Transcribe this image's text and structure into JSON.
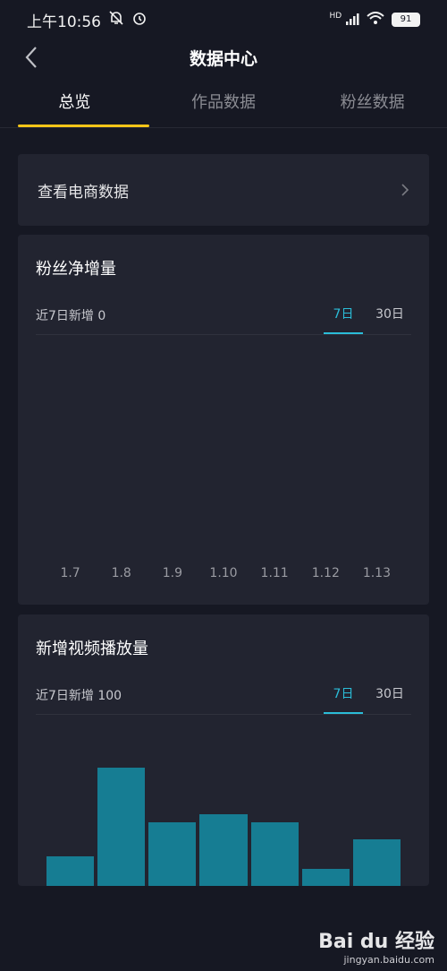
{
  "status_bar": {
    "time": "上午10:56",
    "network": "HD",
    "battery": "91"
  },
  "nav": {
    "title": "数据中心"
  },
  "tabs": [
    {
      "label": "总览",
      "active": true
    },
    {
      "label": "作品数据",
      "active": false
    },
    {
      "label": "粉丝数据",
      "active": false
    }
  ],
  "ecommerce": {
    "label": "查看电商数据"
  },
  "fans_card": {
    "title": "粉丝净增量",
    "summary": "近7日新增 0",
    "ranges": [
      "7日",
      "30日"
    ],
    "active_range": "7日",
    "chart_data": {
      "type": "bar",
      "categories": [
        "1.7",
        "1.8",
        "1.9",
        "1.10",
        "1.11",
        "1.12",
        "1.13"
      ],
      "values": [
        0,
        0,
        0,
        0,
        0,
        0,
        0
      ]
    }
  },
  "plays_card": {
    "title": "新增视频播放量",
    "summary": "近7日新增 100",
    "ranges": [
      "7日",
      "30日"
    ],
    "active_range": "7日",
    "chart_data": {
      "type": "bar",
      "categories": [
        "",
        "",
        "",
        "",
        "",
        "",
        ""
      ],
      "values": [
        7,
        28,
        15,
        17,
        15,
        4,
        11
      ],
      "ylim": [
        0,
        34
      ]
    }
  },
  "watermark": {
    "brand": "Bai du 经验",
    "site": "jingyan.baidu.com"
  },
  "colors": {
    "background": "#161823",
    "card": "#222430",
    "accent_tab": "#f5c518",
    "accent_range": "#2bbdd8",
    "bar": "#167d93"
  }
}
